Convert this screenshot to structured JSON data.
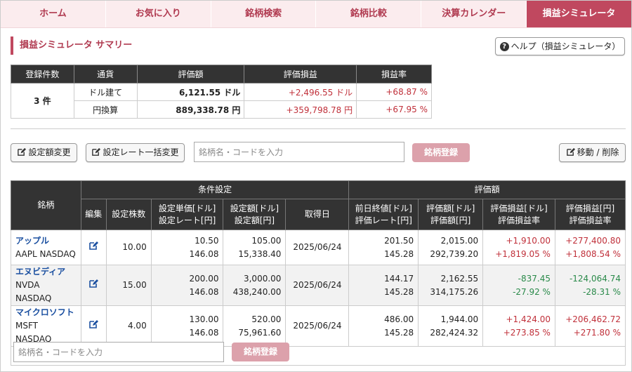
{
  "tabs": [
    {
      "label": "ホーム",
      "active": false
    },
    {
      "label": "お気に入り",
      "active": false
    },
    {
      "label": "銘柄検索",
      "active": false
    },
    {
      "label": "銘柄比較",
      "active": false
    },
    {
      "label": "決算カレンダー",
      "active": false
    },
    {
      "label": "損益シミュレータ",
      "active": true
    }
  ],
  "section_title": "損益シミュレータ サマリー",
  "help_button": "ヘルプ（損益シミュレータ）",
  "summary": {
    "headers": [
      "登録件数",
      "通貨",
      "評価額",
      "評価損益",
      "損益率"
    ],
    "count": "3 件",
    "rows": [
      {
        "currency": "ドル建て",
        "value": "6,121.55 ドル",
        "pl": "+2,496.55 ドル",
        "rate": "+68.87 %"
      },
      {
        "currency": "円換算",
        "value": "889,338.78 円",
        "pl": "+359,798.78 円",
        "rate": "+67.95 %"
      }
    ]
  },
  "toolbar": {
    "set_amount": "設定額変更",
    "set_rate": "設定レート一括変更",
    "search_placeholder": "銘柄名・コードを入力",
    "register": "銘柄登録",
    "move_delete": "移動 / 削除"
  },
  "table": {
    "col_stock": "銘柄",
    "group_condition": "条件設定",
    "group_valuation": "評価額",
    "col_edit": "編集",
    "col_shares": "設定株数",
    "col_unit_1": "設定単価[ドル]",
    "col_unit_2": "設定レート[円]",
    "col_amount_1": "設定額[ドル]",
    "col_amount_2": "設定額[円]",
    "col_date": "取得日",
    "col_prev_1": "前日終値[ドル]",
    "col_prev_2": "評価レート[円]",
    "col_val_1": "評価額[ドル]",
    "col_val_2": "評価額[円]",
    "col_pld_1": "評価損益[ドル]",
    "col_pld_2": "評価損益率",
    "col_ply_1": "評価損益[円]",
    "col_ply_2": "評価損益率",
    "rows": [
      {
        "name": "アップル",
        "code": "AAPL NASDAQ",
        "shares": "10.00",
        "unit": "10.50",
        "rate": "146.08",
        "amt_usd": "105.00",
        "amt_jpy": "15,338.40",
        "date": "2025/06/24",
        "prev": "201.50",
        "eval_rate": "145.28",
        "val_usd": "2,015.00",
        "val_jpy": "292,739.20",
        "pl_usd": "+1,910.00",
        "pl_usd_rate": "+1,819.05 %",
        "pl_jpy": "+277,400.80",
        "pl_jpy_rate": "+1,808.54 %",
        "sign": "up"
      },
      {
        "name": "エヌビディア",
        "code": "NVDA NASDAQ",
        "shares": "15.00",
        "unit": "200.00",
        "rate": "146.08",
        "amt_usd": "3,000.00",
        "amt_jpy": "438,240.00",
        "date": "2025/06/24",
        "prev": "144.17",
        "eval_rate": "145.28",
        "val_usd": "2,162.55",
        "val_jpy": "314,175.26",
        "pl_usd": "-837.45",
        "pl_usd_rate": "-27.92 %",
        "pl_jpy": "-124,064.74",
        "pl_jpy_rate": "-28.31 %",
        "sign": "down"
      },
      {
        "name": "マイクロソフト",
        "code": "MSFT NASDAQ",
        "shares": "4.00",
        "unit": "130.00",
        "rate": "146.08",
        "amt_usd": "520.00",
        "amt_jpy": "75,961.60",
        "date": "2025/06/24",
        "prev": "486.00",
        "eval_rate": "145.28",
        "val_usd": "1,944.00",
        "val_jpy": "282,424.32",
        "pl_usd": "+1,424.00",
        "pl_usd_rate": "+273.85 %",
        "pl_jpy": "+206,462.72",
        "pl_jpy_rate": "+271.80 %",
        "sign": "up"
      }
    ]
  },
  "bottom": {
    "search_placeholder": "銘柄名・コードを入力",
    "register": "銘柄登録"
  }
}
